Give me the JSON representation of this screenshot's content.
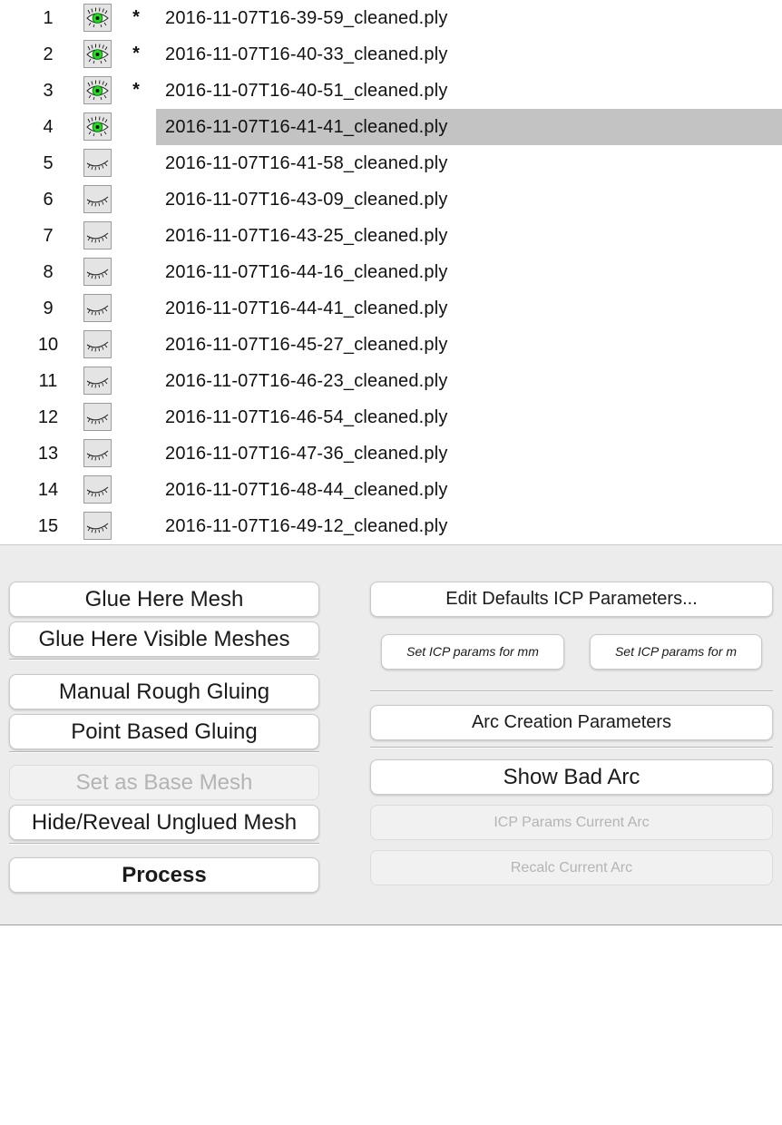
{
  "mesh_list": {
    "rows": [
      {
        "index": "1",
        "visible": true,
        "marker": "*",
        "filename": "2016-11-07T16-39-59_cleaned.ply",
        "selected": false
      },
      {
        "index": "2",
        "visible": true,
        "marker": "*",
        "filename": "2016-11-07T16-40-33_cleaned.ply",
        "selected": false
      },
      {
        "index": "3",
        "visible": true,
        "marker": "*",
        "filename": "2016-11-07T16-40-51_cleaned.ply",
        "selected": false
      },
      {
        "index": "4",
        "visible": true,
        "marker": "",
        "filename": "2016-11-07T16-41-41_cleaned.ply",
        "selected": true
      },
      {
        "index": "5",
        "visible": false,
        "marker": "",
        "filename": "2016-11-07T16-41-58_cleaned.ply",
        "selected": false
      },
      {
        "index": "6",
        "visible": false,
        "marker": "",
        "filename": "2016-11-07T16-43-09_cleaned.ply",
        "selected": false
      },
      {
        "index": "7",
        "visible": false,
        "marker": "",
        "filename": "2016-11-07T16-43-25_cleaned.ply",
        "selected": false
      },
      {
        "index": "8",
        "visible": false,
        "marker": "",
        "filename": "2016-11-07T16-44-16_cleaned.ply",
        "selected": false
      },
      {
        "index": "9",
        "visible": false,
        "marker": "",
        "filename": "2016-11-07T16-44-41_cleaned.ply",
        "selected": false
      },
      {
        "index": "10",
        "visible": false,
        "marker": "",
        "filename": "2016-11-07T16-45-27_cleaned.ply",
        "selected": false
      },
      {
        "index": "11",
        "visible": false,
        "marker": "",
        "filename": "2016-11-07T16-46-23_cleaned.ply",
        "selected": false
      },
      {
        "index": "12",
        "visible": false,
        "marker": "",
        "filename": "2016-11-07T16-46-54_cleaned.ply",
        "selected": false
      },
      {
        "index": "13",
        "visible": false,
        "marker": "",
        "filename": "2016-11-07T16-47-36_cleaned.ply",
        "selected": false
      },
      {
        "index": "14",
        "visible": false,
        "marker": "",
        "filename": "2016-11-07T16-48-44_cleaned.ply",
        "selected": false
      },
      {
        "index": "15",
        "visible": false,
        "marker": "",
        "filename": "2016-11-07T16-49-12_cleaned.ply",
        "selected": false
      }
    ],
    "icons": {
      "visible": "eye-open-icon",
      "hidden": "eye-closed-icon"
    }
  },
  "buttons": {
    "glue_here_mesh": "Glue Here Mesh",
    "glue_here_visible_meshes": "Glue Here Visible Meshes",
    "manual_rough_gluing": "Manual Rough Gluing",
    "point_based_gluing": "Point Based Gluing",
    "set_as_base_mesh": "Set as Base Mesh",
    "hide_reveal_unglued_mesh": "Hide/Reveal Unglued Mesh",
    "process": "Process",
    "edit_defaults_icp": "Edit Defaults ICP Parameters...",
    "set_icp_mm": "Set ICP params for mm",
    "set_icp_m": "Set ICP params for m",
    "arc_creation_parameters": "Arc Creation Parameters",
    "show_bad_arc": "Show Bad Arc",
    "icp_params_current_arc": "ICP Params Current Arc",
    "recalc_current_arc": "Recalc Current Arc"
  },
  "colors": {
    "selected_row": "#c3c3c3",
    "eye_iris": "#22dd22",
    "panel_bg": "#ececec"
  }
}
